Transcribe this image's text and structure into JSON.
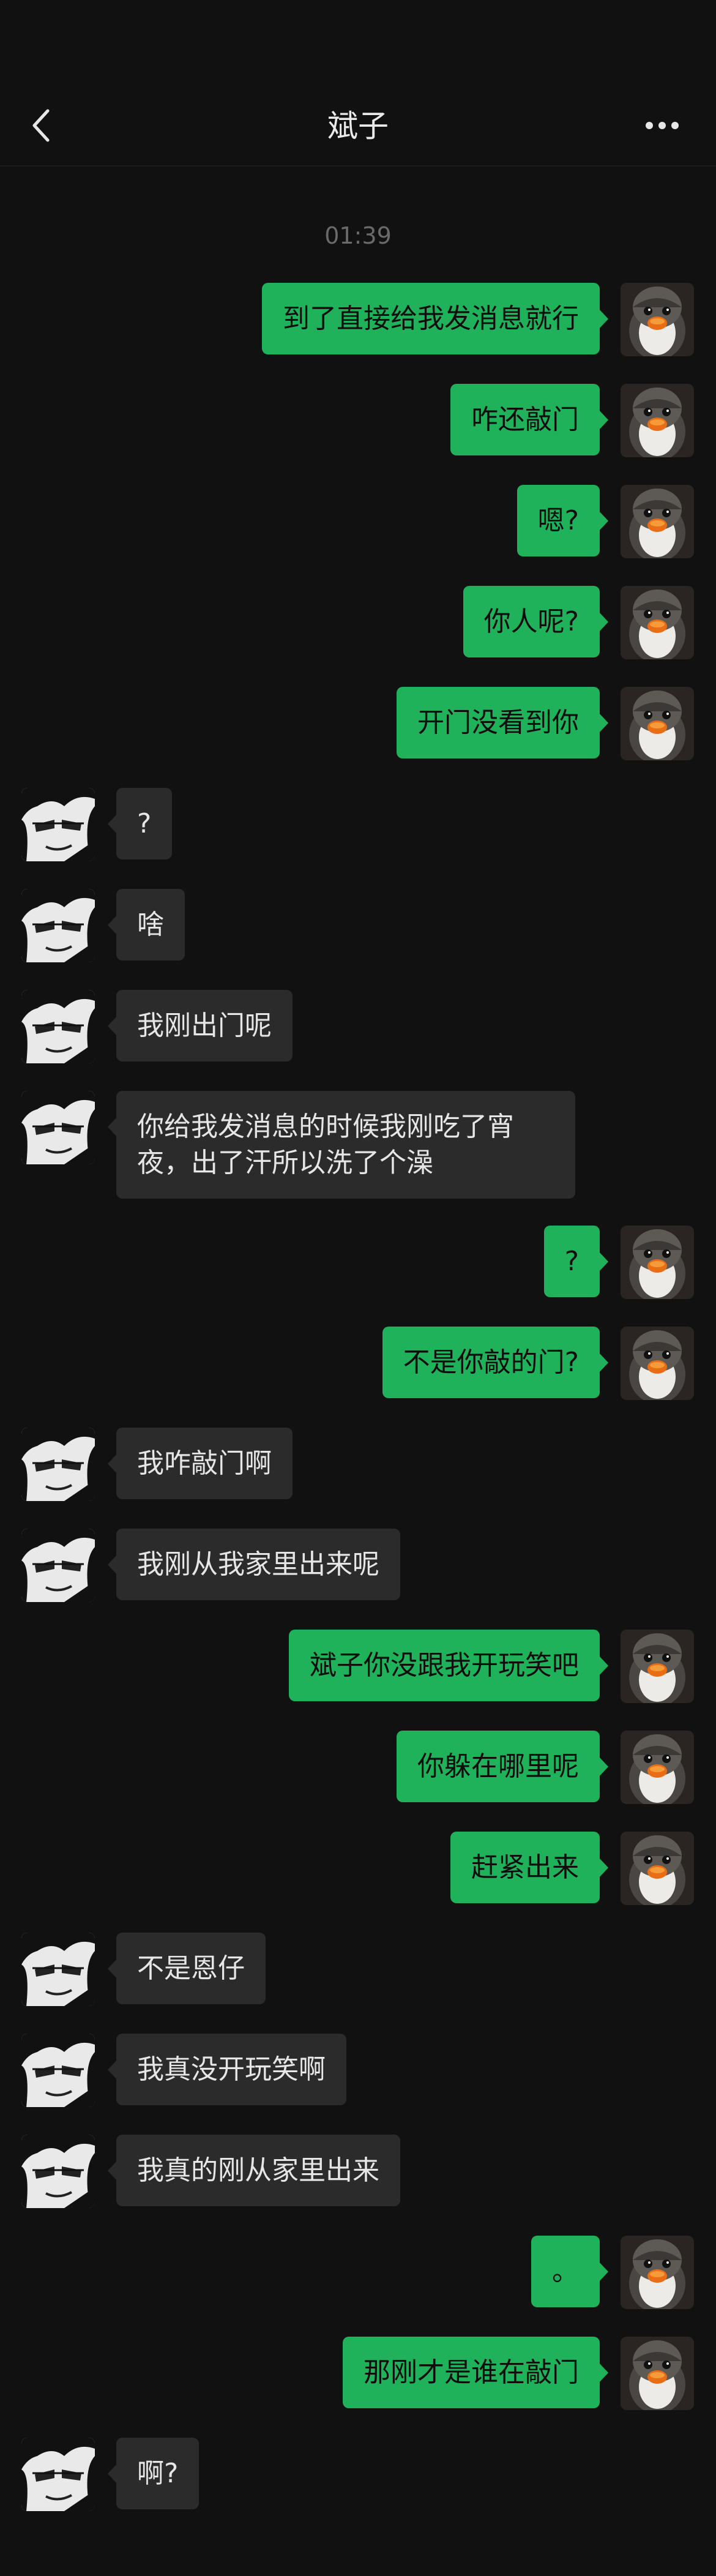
{
  "header": {
    "title": "斌子",
    "back_icon": "chevron-left-icon",
    "more_icon": "more-dots-icon"
  },
  "timestamp": "01:39",
  "colors": {
    "background": "#111111",
    "outgoing_bubble": "#1fb25a",
    "incoming_bubble": "#2b2b2b"
  },
  "messages": [
    {
      "direction": "out",
      "text": "到了直接给我发消息就行"
    },
    {
      "direction": "out",
      "text": "咋还敲门"
    },
    {
      "direction": "out",
      "text": "嗯?"
    },
    {
      "direction": "out",
      "text": "你人呢?"
    },
    {
      "direction": "out",
      "text": "开门没看到你"
    },
    {
      "direction": "in",
      "text": "?"
    },
    {
      "direction": "in",
      "text": "啥"
    },
    {
      "direction": "in",
      "text": "我刚出门呢"
    },
    {
      "direction": "in",
      "text": "你给我发消息的时候我刚吃了宵夜，出了汗所以洗了个澡"
    },
    {
      "direction": "out",
      "text": "?"
    },
    {
      "direction": "out",
      "text": "不是你敲的门?"
    },
    {
      "direction": "in",
      "text": "我咋敲门啊"
    },
    {
      "direction": "in",
      "text": "我刚从我家里出来呢"
    },
    {
      "direction": "out",
      "text": "斌子你没跟我开玩笑吧"
    },
    {
      "direction": "out",
      "text": "你躲在哪里呢"
    },
    {
      "direction": "out",
      "text": "赶紧出来"
    },
    {
      "direction": "in",
      "text": "不是恩仔"
    },
    {
      "direction": "in",
      "text": "我真没开玩笑啊"
    },
    {
      "direction": "in",
      "text": "我真的刚从家里出来"
    },
    {
      "direction": "out",
      "text": "。"
    },
    {
      "direction": "out",
      "text": "那刚才是谁在敲门"
    },
    {
      "direction": "in",
      "text": "啊?"
    }
  ]
}
